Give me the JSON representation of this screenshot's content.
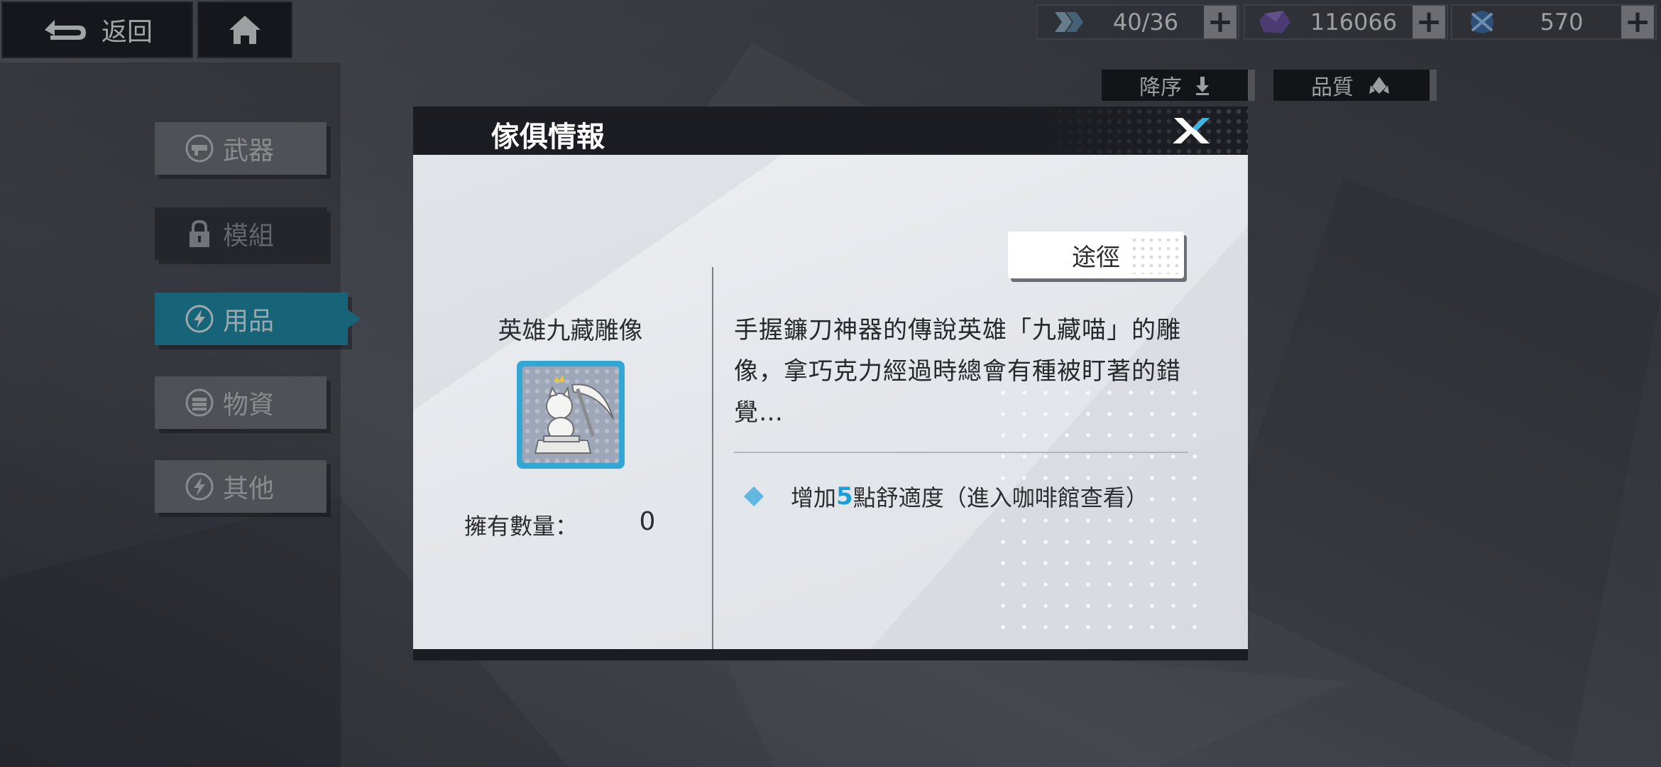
{
  "topbar": {
    "back_label": "返回",
    "resources": [
      {
        "icon": "stamina-icon",
        "value": "40/36"
      },
      {
        "icon": "crystal-icon",
        "value": "116066"
      },
      {
        "icon": "special-currency-icon",
        "value": "570"
      }
    ],
    "plus_label": "+"
  },
  "sort": {
    "order_label": "降序",
    "quality_label": "品質"
  },
  "tabs": [
    {
      "label": "武器",
      "icon": "weapon-icon",
      "state": "normal"
    },
    {
      "label": "模組",
      "icon": "lock-icon",
      "state": "locked"
    },
    {
      "label": "用品",
      "icon": "lightning-icon",
      "state": "active"
    },
    {
      "label": "物資",
      "icon": "supplies-icon",
      "state": "normal"
    },
    {
      "label": "其他",
      "icon": "lightning-icon",
      "state": "normal"
    }
  ],
  "modal": {
    "title": "傢俱情報",
    "route_label": "途徑",
    "item_name": "英雄九藏雕像",
    "quantity_label": "擁有數量：",
    "quantity_value": "0",
    "description": "手握鐮刀神器的傳說英雄「九藏喵」的雕像，拿巧克力經過時總會有種被盯著的錯覺…",
    "effect": {
      "prefix": "增加",
      "number": "5",
      "suffix": "點舒適度（進入咖啡館查看）"
    }
  },
  "colors": {
    "active_tab": "#1a8ca8",
    "icon_frame": "#32a6d4",
    "effect_highlight": "#1aa0d8",
    "modal_header": "#1b1d22"
  }
}
